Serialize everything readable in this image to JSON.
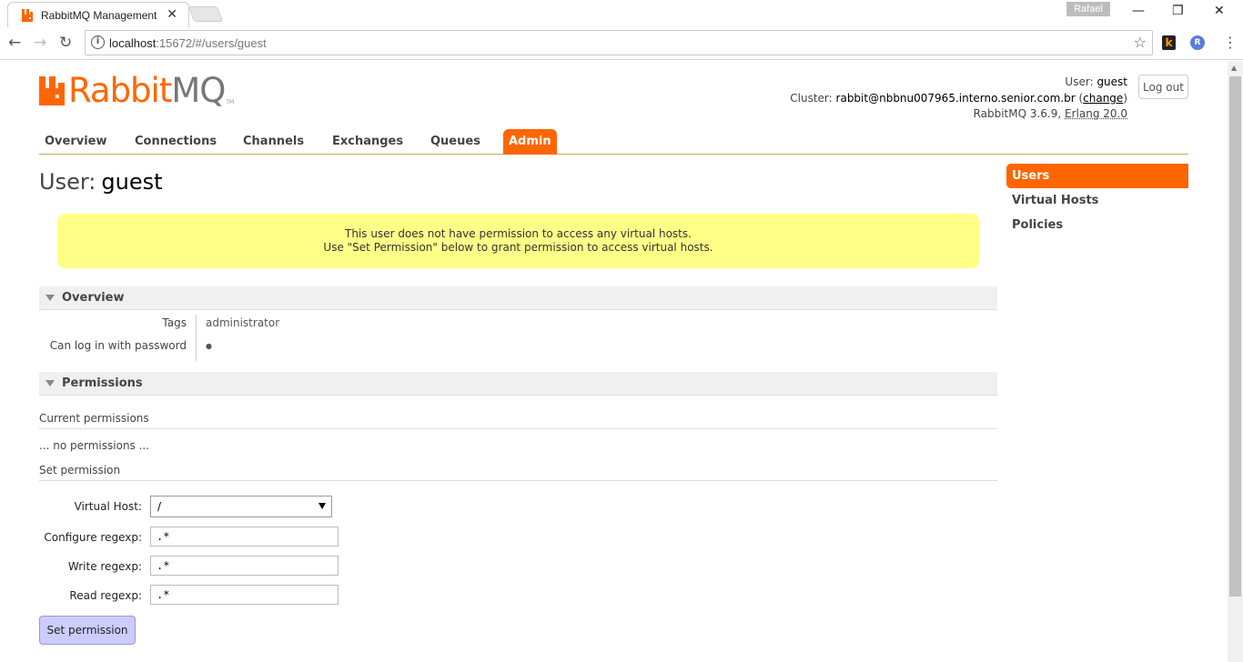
{
  "browser": {
    "tab_title": "RabbitMQ Management",
    "tab_close": "✕",
    "profile_name": "Rafael",
    "url_host": "localhost",
    "url_rest": ":15672/#/users/guest",
    "window_minimize": "—",
    "window_restore": "❐",
    "window_close": "✕",
    "ext_k_label": "k",
    "ext_r_label": "R"
  },
  "logo": {
    "rabbit": "Rabbit",
    "mq": "MQ",
    "tm": "TM"
  },
  "header": {
    "user_label": "User:",
    "user_value": "guest",
    "cluster_label": "Cluster:",
    "cluster_value": "rabbit@nbbnu007965.interno.senior.com.br",
    "change_open": "(",
    "change_link": "change",
    "change_close": ")",
    "version": "RabbitMQ 3.6.9,",
    "erlang": "Erlang 20.0",
    "logout_label": "Log out"
  },
  "nav": {
    "items": [
      {
        "label": "Overview"
      },
      {
        "label": "Connections"
      },
      {
        "label": "Channels"
      },
      {
        "label": "Exchanges"
      },
      {
        "label": "Queues"
      },
      {
        "label": "Admin"
      }
    ]
  },
  "page": {
    "title_label": "User:",
    "title_value": "guest"
  },
  "warning": {
    "line1": "This user does not have permission to access any virtual hosts.",
    "line2": "Use \"Set Permission\" below to grant permission to access virtual hosts."
  },
  "overview": {
    "header": "Overview",
    "tags_label": "Tags",
    "tags_value": "administrator",
    "login_label": "Can log in with password",
    "login_value": "●"
  },
  "permissions": {
    "header": "Permissions",
    "current_label": "Current permissions",
    "none_text": "... no permissions ...",
    "set_label": "Set permission",
    "vhost_label": "Virtual Host:",
    "vhost_value": "/",
    "configure_label": "Configure regexp:",
    "configure_value": ".*",
    "write_label": "Write regexp:",
    "write_value": ".*",
    "read_label": "Read regexp:",
    "read_value": ".*",
    "submit_label": "Set permission"
  },
  "sidebar": {
    "items": [
      {
        "label": "Users"
      },
      {
        "label": "Virtual Hosts"
      },
      {
        "label": "Policies"
      }
    ]
  },
  "colors": {
    "accent": "#ff6600",
    "warning_bg": "#ffff88",
    "button_bg": "#ccccff"
  }
}
